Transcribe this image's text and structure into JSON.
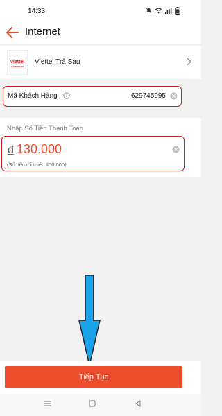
{
  "status": {
    "time": "14:33"
  },
  "header": {
    "title": "Internet"
  },
  "provider": {
    "logo_text": "viettel",
    "name": "Viettel Trả Sau"
  },
  "customer": {
    "label": "Mã Khách Hàng",
    "value": "629745995"
  },
  "amount": {
    "label": "Nhập Số Tiền Thanh Toán",
    "currency": "đ",
    "value": "130.000",
    "min_note": "(Số tiền tối thiểu ₫50.000)"
  },
  "cta": {
    "label": "Tiếp Tục"
  },
  "colors": {
    "accent": "#ee4d2d",
    "highlight_border": "#d01c1c",
    "arrow": "#1aa3e8"
  },
  "icons": [
    "back-arrow-icon",
    "chevron-right-icon",
    "info-icon",
    "clear-icon",
    "down-arrow-icon"
  ]
}
